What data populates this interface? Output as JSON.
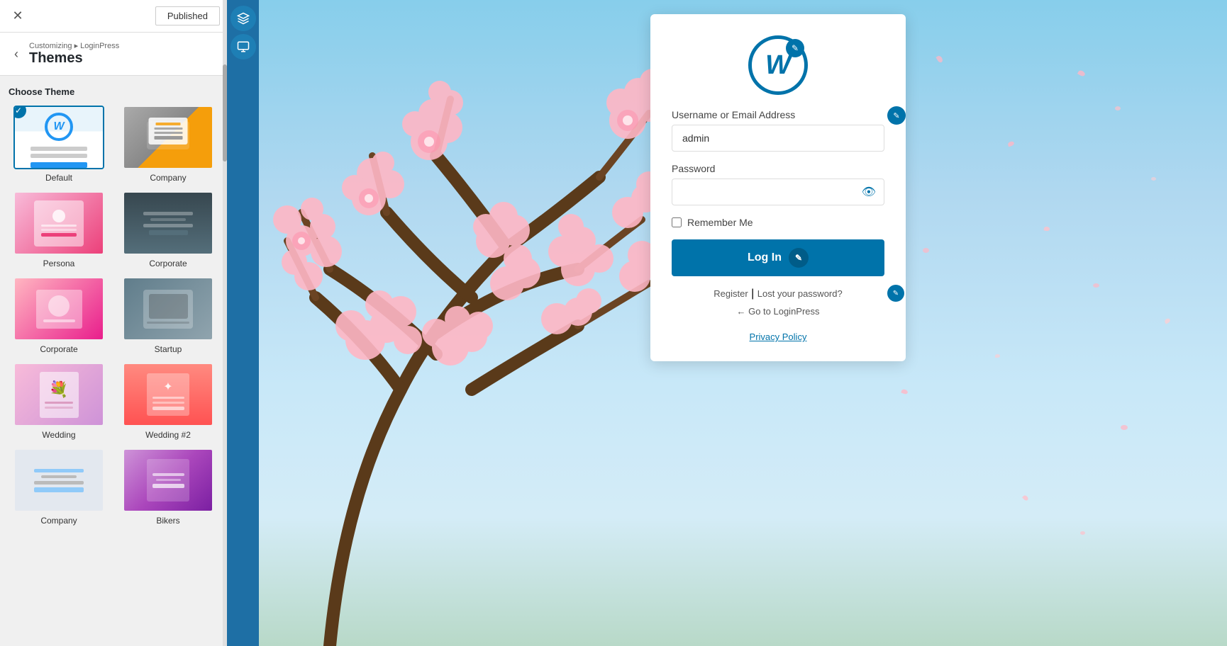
{
  "topbar": {
    "close_label": "✕",
    "published_label": "Published"
  },
  "sidebar": {
    "back_label": "‹",
    "breadcrumb": "Customizing ▸ LoginPress",
    "title": "Themes",
    "choose_theme_label": "Choose Theme",
    "themes": [
      {
        "id": "default",
        "label": "Default",
        "selected": true
      },
      {
        "id": "company",
        "label": "Company",
        "selected": false
      },
      {
        "id": "persona",
        "label": "Persona",
        "selected": false
      },
      {
        "id": "corporate",
        "label": "Corporate",
        "selected": false
      },
      {
        "id": "corporate2",
        "label": "Corporate",
        "selected": false
      },
      {
        "id": "startup",
        "label": "Startup",
        "selected": false
      },
      {
        "id": "wedding",
        "label": "Wedding",
        "selected": false
      },
      {
        "id": "wedding2",
        "label": "Wedding #2",
        "selected": false
      },
      {
        "id": "company2",
        "label": "Company",
        "selected": false
      },
      {
        "id": "bikers",
        "label": "Bikers",
        "selected": false
      }
    ]
  },
  "toolbar": {
    "icon1": "✎",
    "icon2": "⧉"
  },
  "login_form": {
    "username_label": "Username or Email Address",
    "username_value": "admin",
    "password_label": "Password",
    "password_value": "",
    "remember_label": "Remember Me",
    "login_button": "Log In",
    "register_link": "Register",
    "separator": "|",
    "lost_password_link": "Lost your password?",
    "go_to_label": "← Go to LoginPress",
    "privacy_link": "Privacy Policy"
  },
  "colors": {
    "primary": "#0073aa",
    "bg_sky": "#87ceeb",
    "panel_bg": "#fff"
  }
}
